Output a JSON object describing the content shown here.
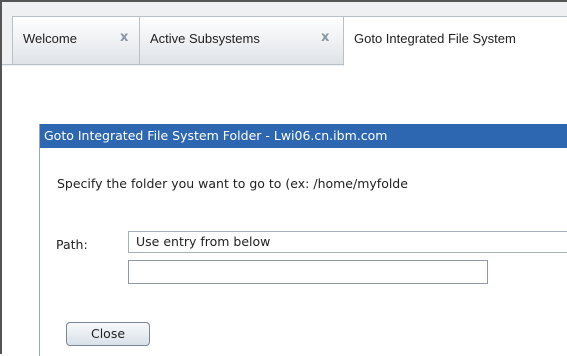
{
  "tabs": [
    {
      "label": "Welcome",
      "close": "x",
      "active": false
    },
    {
      "label": "Active Subsystems",
      "close": "x",
      "active": false
    },
    {
      "label": "Goto Integrated File System",
      "active": true
    }
  ],
  "dialog": {
    "title": "Goto Integrated File System Folder - Lwi06.cn.ibm.com",
    "instructions": "Specify the folder you want to go to (ex: /home/myfolde",
    "path_label": "Path:",
    "path_option": "Use entry from below",
    "path_value": "",
    "close_label": "Close"
  },
  "colors": {
    "title_bar": "#2e67b1",
    "tab_close": "#8a96a3"
  }
}
